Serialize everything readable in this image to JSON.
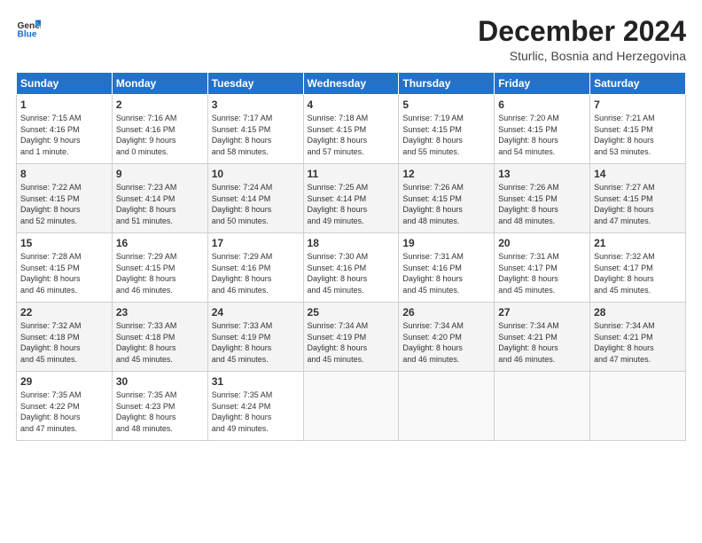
{
  "header": {
    "logo_line1": "General",
    "logo_line2": "Blue",
    "month_title": "December 2024",
    "location": "Sturlic, Bosnia and Herzegovina"
  },
  "weekdays": [
    "Sunday",
    "Monday",
    "Tuesday",
    "Wednesday",
    "Thursday",
    "Friday",
    "Saturday"
  ],
  "weeks": [
    [
      {
        "day": "1",
        "info": "Sunrise: 7:15 AM\nSunset: 4:16 PM\nDaylight: 9 hours\nand 1 minute."
      },
      {
        "day": "2",
        "info": "Sunrise: 7:16 AM\nSunset: 4:16 PM\nDaylight: 9 hours\nand 0 minutes."
      },
      {
        "day": "3",
        "info": "Sunrise: 7:17 AM\nSunset: 4:15 PM\nDaylight: 8 hours\nand 58 minutes."
      },
      {
        "day": "4",
        "info": "Sunrise: 7:18 AM\nSunset: 4:15 PM\nDaylight: 8 hours\nand 57 minutes."
      },
      {
        "day": "5",
        "info": "Sunrise: 7:19 AM\nSunset: 4:15 PM\nDaylight: 8 hours\nand 55 minutes."
      },
      {
        "day": "6",
        "info": "Sunrise: 7:20 AM\nSunset: 4:15 PM\nDaylight: 8 hours\nand 54 minutes."
      },
      {
        "day": "7",
        "info": "Sunrise: 7:21 AM\nSunset: 4:15 PM\nDaylight: 8 hours\nand 53 minutes."
      }
    ],
    [
      {
        "day": "8",
        "info": "Sunrise: 7:22 AM\nSunset: 4:15 PM\nDaylight: 8 hours\nand 52 minutes."
      },
      {
        "day": "9",
        "info": "Sunrise: 7:23 AM\nSunset: 4:14 PM\nDaylight: 8 hours\nand 51 minutes."
      },
      {
        "day": "10",
        "info": "Sunrise: 7:24 AM\nSunset: 4:14 PM\nDaylight: 8 hours\nand 50 minutes."
      },
      {
        "day": "11",
        "info": "Sunrise: 7:25 AM\nSunset: 4:14 PM\nDaylight: 8 hours\nand 49 minutes."
      },
      {
        "day": "12",
        "info": "Sunrise: 7:26 AM\nSunset: 4:15 PM\nDaylight: 8 hours\nand 48 minutes."
      },
      {
        "day": "13",
        "info": "Sunrise: 7:26 AM\nSunset: 4:15 PM\nDaylight: 8 hours\nand 48 minutes."
      },
      {
        "day": "14",
        "info": "Sunrise: 7:27 AM\nSunset: 4:15 PM\nDaylight: 8 hours\nand 47 minutes."
      }
    ],
    [
      {
        "day": "15",
        "info": "Sunrise: 7:28 AM\nSunset: 4:15 PM\nDaylight: 8 hours\nand 46 minutes."
      },
      {
        "day": "16",
        "info": "Sunrise: 7:29 AM\nSunset: 4:15 PM\nDaylight: 8 hours\nand 46 minutes."
      },
      {
        "day": "17",
        "info": "Sunrise: 7:29 AM\nSunset: 4:16 PM\nDaylight: 8 hours\nand 46 minutes."
      },
      {
        "day": "18",
        "info": "Sunrise: 7:30 AM\nSunset: 4:16 PM\nDaylight: 8 hours\nand 45 minutes."
      },
      {
        "day": "19",
        "info": "Sunrise: 7:31 AM\nSunset: 4:16 PM\nDaylight: 8 hours\nand 45 minutes."
      },
      {
        "day": "20",
        "info": "Sunrise: 7:31 AM\nSunset: 4:17 PM\nDaylight: 8 hours\nand 45 minutes."
      },
      {
        "day": "21",
        "info": "Sunrise: 7:32 AM\nSunset: 4:17 PM\nDaylight: 8 hours\nand 45 minutes."
      }
    ],
    [
      {
        "day": "22",
        "info": "Sunrise: 7:32 AM\nSunset: 4:18 PM\nDaylight: 8 hours\nand 45 minutes."
      },
      {
        "day": "23",
        "info": "Sunrise: 7:33 AM\nSunset: 4:18 PM\nDaylight: 8 hours\nand 45 minutes."
      },
      {
        "day": "24",
        "info": "Sunrise: 7:33 AM\nSunset: 4:19 PM\nDaylight: 8 hours\nand 45 minutes."
      },
      {
        "day": "25",
        "info": "Sunrise: 7:34 AM\nSunset: 4:19 PM\nDaylight: 8 hours\nand 45 minutes."
      },
      {
        "day": "26",
        "info": "Sunrise: 7:34 AM\nSunset: 4:20 PM\nDaylight: 8 hours\nand 46 minutes."
      },
      {
        "day": "27",
        "info": "Sunrise: 7:34 AM\nSunset: 4:21 PM\nDaylight: 8 hours\nand 46 minutes."
      },
      {
        "day": "28",
        "info": "Sunrise: 7:34 AM\nSunset: 4:21 PM\nDaylight: 8 hours\nand 47 minutes."
      }
    ],
    [
      {
        "day": "29",
        "info": "Sunrise: 7:35 AM\nSunset: 4:22 PM\nDaylight: 8 hours\nand 47 minutes."
      },
      {
        "day": "30",
        "info": "Sunrise: 7:35 AM\nSunset: 4:23 PM\nDaylight: 8 hours\nand 48 minutes."
      },
      {
        "day": "31",
        "info": "Sunrise: 7:35 AM\nSunset: 4:24 PM\nDaylight: 8 hours\nand 49 minutes."
      },
      {
        "day": "",
        "info": ""
      },
      {
        "day": "",
        "info": ""
      },
      {
        "day": "",
        "info": ""
      },
      {
        "day": "",
        "info": ""
      }
    ]
  ]
}
